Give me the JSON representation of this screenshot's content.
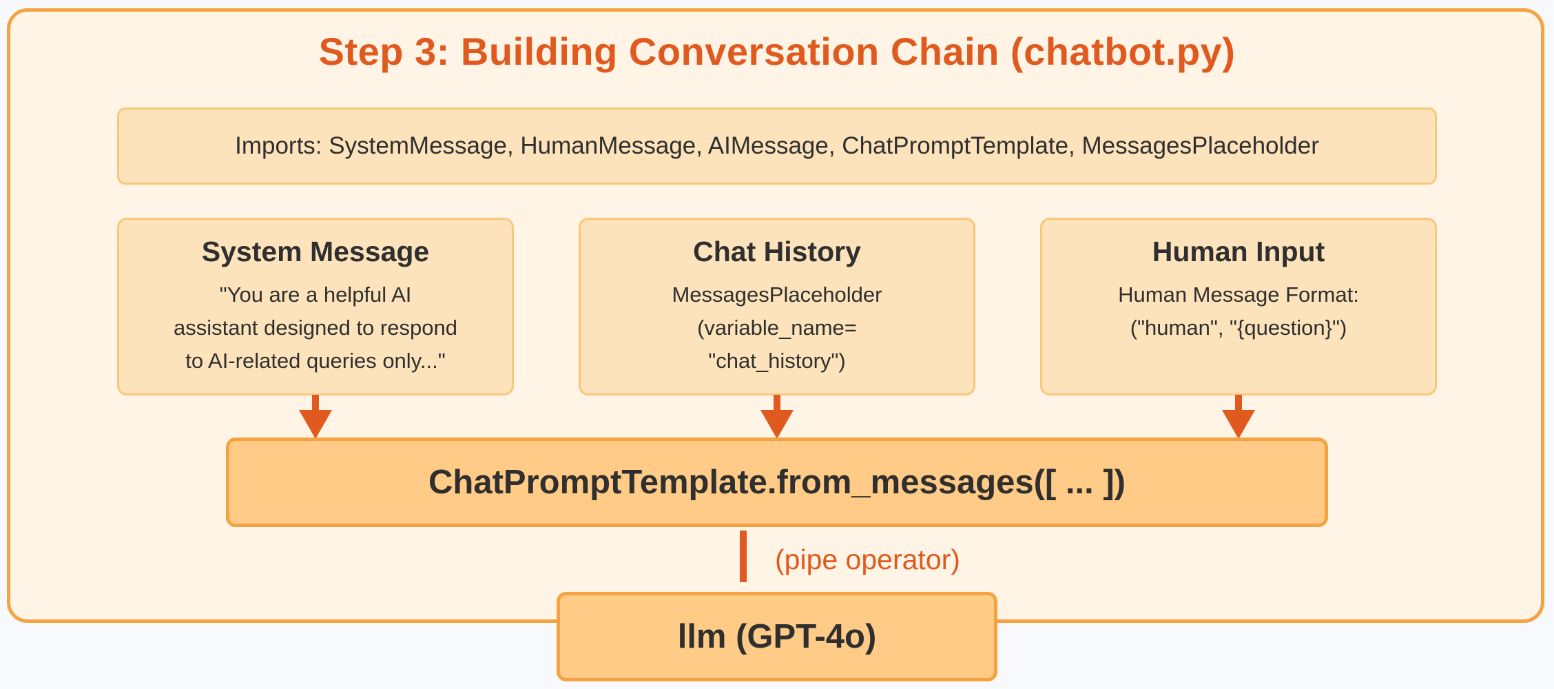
{
  "diagram": {
    "title": "Step 3: Building Conversation Chain (chatbot.py)",
    "imports": "Imports: SystemMessage, HumanMessage, AIMessage, ChatPromptTemplate, MessagesPlaceholder",
    "cards": [
      {
        "title": "System Message",
        "lines": [
          "\"You are a helpful AI",
          "assistant designed to respond",
          "to AI-related queries only...\""
        ]
      },
      {
        "title": "Chat History",
        "lines": [
          "MessagesPlaceholder",
          "(variable_name=",
          "\"chat_history\")"
        ]
      },
      {
        "title": "Human Input",
        "lines": [
          "Human Message Format:",
          "(\"human\", \"{question}\")"
        ]
      }
    ],
    "template_box": "ChatPromptTemplate.from_messages([ ... ])",
    "pipe_label": "(pipe operator)",
    "llm_box": "llm (GPT-4o)"
  },
  "colors": {
    "accent": "#e05a1f",
    "frame_border": "#f4a340",
    "frame_fill": "#fff4e6",
    "box_fill": "#fde3bb",
    "main_box_fill": "#ffcb86"
  },
  "icons": {
    "arrow": "down-arrow-icon",
    "pipe": "pipe-connector"
  }
}
